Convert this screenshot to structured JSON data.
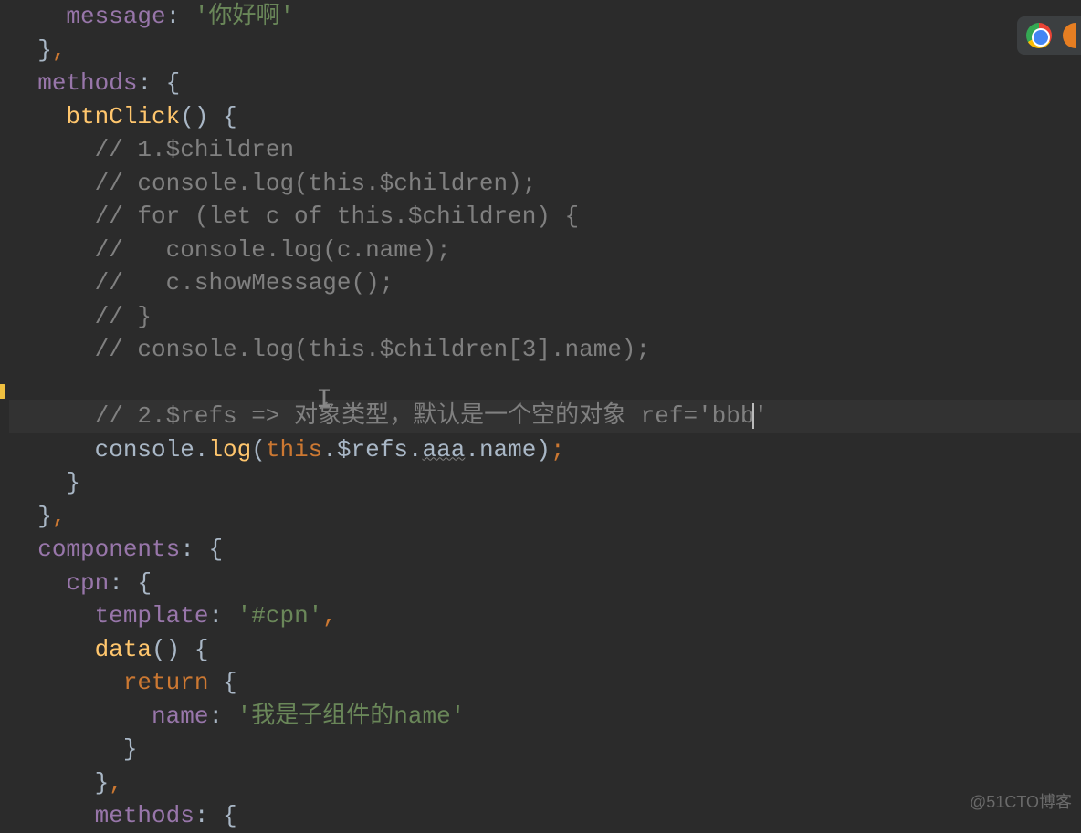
{
  "code": {
    "l0_key": "message",
    "l0_string": "'你好啊'",
    "l1": "  }",
    "l2_key": "methods",
    "l3_func": "btnClick",
    "l4_comment": "// 1.$children",
    "l5_comment": "// console.log(this.$children);",
    "l6_comment": "// for (let c of this.$children) {",
    "l7_comment": "//   console.log(c.name);",
    "l8_comment": "//   c.showMessage();",
    "l9_comment": "// }",
    "l10_comment": "// console.log(this.$children[3].name);",
    "l12_comment_a": "// 2.$refs => ",
    "l12_comment_b": "对象类型，默认是一个空的对象 ref='bbb",
    "l12_comment_c": "'",
    "l13_console": "console",
    "l13_log": "log",
    "l13_this": "this",
    "l13_refs": "$refs",
    "l13_aaa": "aaa",
    "l13_name": "name",
    "l16_key": "components",
    "l17_key": "cpn",
    "l18_key": "template",
    "l18_string": "'#cpn'",
    "l19_func": "data",
    "l20_return": "return",
    "l21_key": "name",
    "l21_string": "'我是子组件的name'",
    "l24_key": "methods"
  },
  "watermark": "@51CTO博客"
}
